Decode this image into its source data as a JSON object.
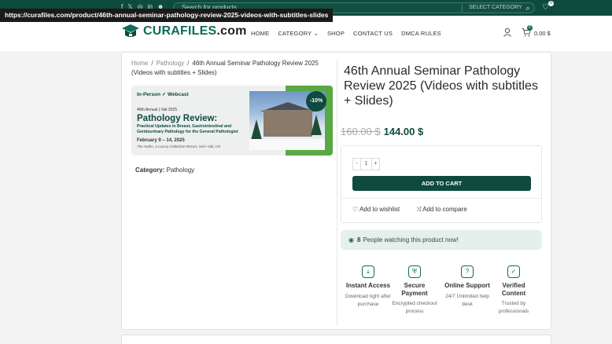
{
  "topbar": {
    "social_icons": [
      "f",
      "𝕏",
      "◎",
      "in",
      "☻"
    ],
    "search_placeholder": "Search for products",
    "category_select": "SELECT CATEGORY",
    "wishlist_count": "0"
  },
  "url_tooltip": "https://curafiles.com/product/46th-annual-seminar-pathology-review-2025-videos-with-subtitles-slides",
  "header": {
    "logo_main": "CURAFILES",
    "logo_ext": ".com",
    "nav": [
      "HOME",
      "CATEGORY",
      "SHOP",
      "CONTACT US",
      "DMCA RULES"
    ],
    "nav_dropdown_mark": "⌄",
    "cart_count": "0",
    "cart_total": "0.00 $"
  },
  "breadcrumb": {
    "home": "Home",
    "category": "Pathology",
    "current": "46th Annual Seminar Pathology Review 2025 (Videos with subtitles + Slides)",
    "separator": "/"
  },
  "banner": {
    "format": "In-Person ✓ Webcast",
    "annual": "46th Annual | Vail 2025",
    "title": "Pathology Review:",
    "subtitle": "Practical Updates in Breast, Gastrointestinal and Genitourinary Pathology for the General Pathologist",
    "dates": "February 9 – 14, 2025",
    "venue": "The Hythe, a Luxury Collection Resort, Vail • Vail, CO",
    "discount": "-10%"
  },
  "category": {
    "label": "Category:",
    "value": "Pathology"
  },
  "product": {
    "title": "46th Annual Seminar Pathology Review 2025 (Videos with subtitles + Slides)",
    "old_price": "160.00 $",
    "new_price": "144.00 $",
    "qty_minus": "-",
    "qty_value": "1",
    "qty_plus": "+",
    "add_to_cart": "ADD TO CART",
    "wishlist": "Add to wishlist",
    "compare": "Add to compare"
  },
  "watching": {
    "count": "8",
    "text": "People watching this product now!"
  },
  "features": [
    {
      "icon": "download-icon",
      "glyph": "⤓",
      "title": "Instant Access",
      "desc": "Download right after purchase"
    },
    {
      "icon": "secure-payment-icon",
      "glyph": "⛨",
      "title": "Secure Payment",
      "desc": "Encrypted checkout process"
    },
    {
      "icon": "support-icon",
      "glyph": "?",
      "title": "Online Support",
      "desc": "24/7 Unlimited help desk"
    },
    {
      "icon": "verified-icon",
      "glyph": "✓",
      "title": "Verified Content",
      "desc": "Trusted by professionals"
    }
  ]
}
